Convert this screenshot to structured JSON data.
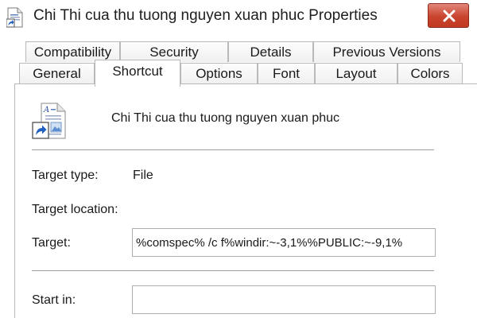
{
  "window": {
    "title": "Chi Thi cua thu tuong nguyen xuan phuc Properties"
  },
  "tabs": {
    "row1": [
      {
        "label": "Compatibility"
      },
      {
        "label": "Security"
      },
      {
        "label": "Details"
      },
      {
        "label": "Previous Versions"
      }
    ],
    "row2": [
      {
        "label": "General"
      },
      {
        "label": "Shortcut",
        "active": true
      },
      {
        "label": "Options"
      },
      {
        "label": "Font"
      },
      {
        "label": "Layout"
      },
      {
        "label": "Colors"
      }
    ]
  },
  "shortcut": {
    "file_name": "Chi Thi cua thu tuong nguyen xuan phuc",
    "target_type_label": "Target type:",
    "target_type_value": "File",
    "target_location_label": "Target location:",
    "target_label": "Target:",
    "target_value": "%comspec% /c f%windir:~-3,1%%PUBLIC:~-9,1%",
    "start_in_label": "Start in:",
    "start_in_value": ""
  },
  "icons": {
    "title": "document-shortcut-icon",
    "file": "document-shortcut-icon",
    "close": "close-icon"
  },
  "colors": {
    "close_button": "#c9442e",
    "border": "#b9b9b9"
  }
}
